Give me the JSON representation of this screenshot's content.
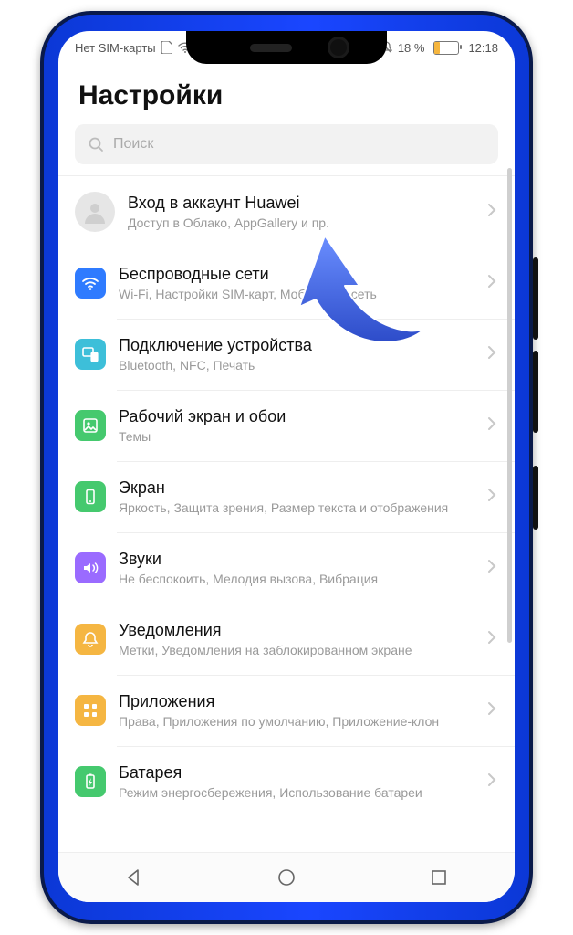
{
  "status": {
    "sim_text": "Нет SIM-карты",
    "battery_text": "18 %",
    "time": "12:18"
  },
  "page_title": "Настройки",
  "search": {
    "placeholder": "Поиск"
  },
  "account": {
    "title": "Вход в аккаунт Huawei",
    "subtitle": "Доступ в Облако, AppGallery и пр."
  },
  "items": [
    {
      "icon": "wifi-icon",
      "color": "c-blue",
      "title": "Беспроводные сети",
      "subtitle": "Wi-Fi, Настройки SIM-карт, Мобильная сеть"
    },
    {
      "icon": "devices-icon",
      "color": "c-teal",
      "title": "Подключение устройства",
      "subtitle": "Bluetooth, NFC, Печать"
    },
    {
      "icon": "wallpaper-icon",
      "color": "c-green",
      "title": "Рабочий экран и обои",
      "subtitle": "Темы"
    },
    {
      "icon": "display-icon",
      "color": "c-green2",
      "title": "Экран",
      "subtitle": "Яркость, Защита зрения, Размер текста и отображения"
    },
    {
      "icon": "sound-icon",
      "color": "c-purple",
      "title": "Звуки",
      "subtitle": "Не беспокоить, Мелодия вызова, Вибрация"
    },
    {
      "icon": "bell-icon",
      "color": "c-amber",
      "title": "Уведомления",
      "subtitle": "Метки, Уведомления на заблокированном экране"
    },
    {
      "icon": "apps-icon",
      "color": "c-amber2",
      "title": "Приложения",
      "subtitle": "Права, Приложения по умолчанию, Приложение-клон"
    },
    {
      "icon": "battery-icon",
      "color": "c-green3",
      "title": "Батарея",
      "subtitle": "Режим энергосбережения, Использование батареи"
    }
  ]
}
